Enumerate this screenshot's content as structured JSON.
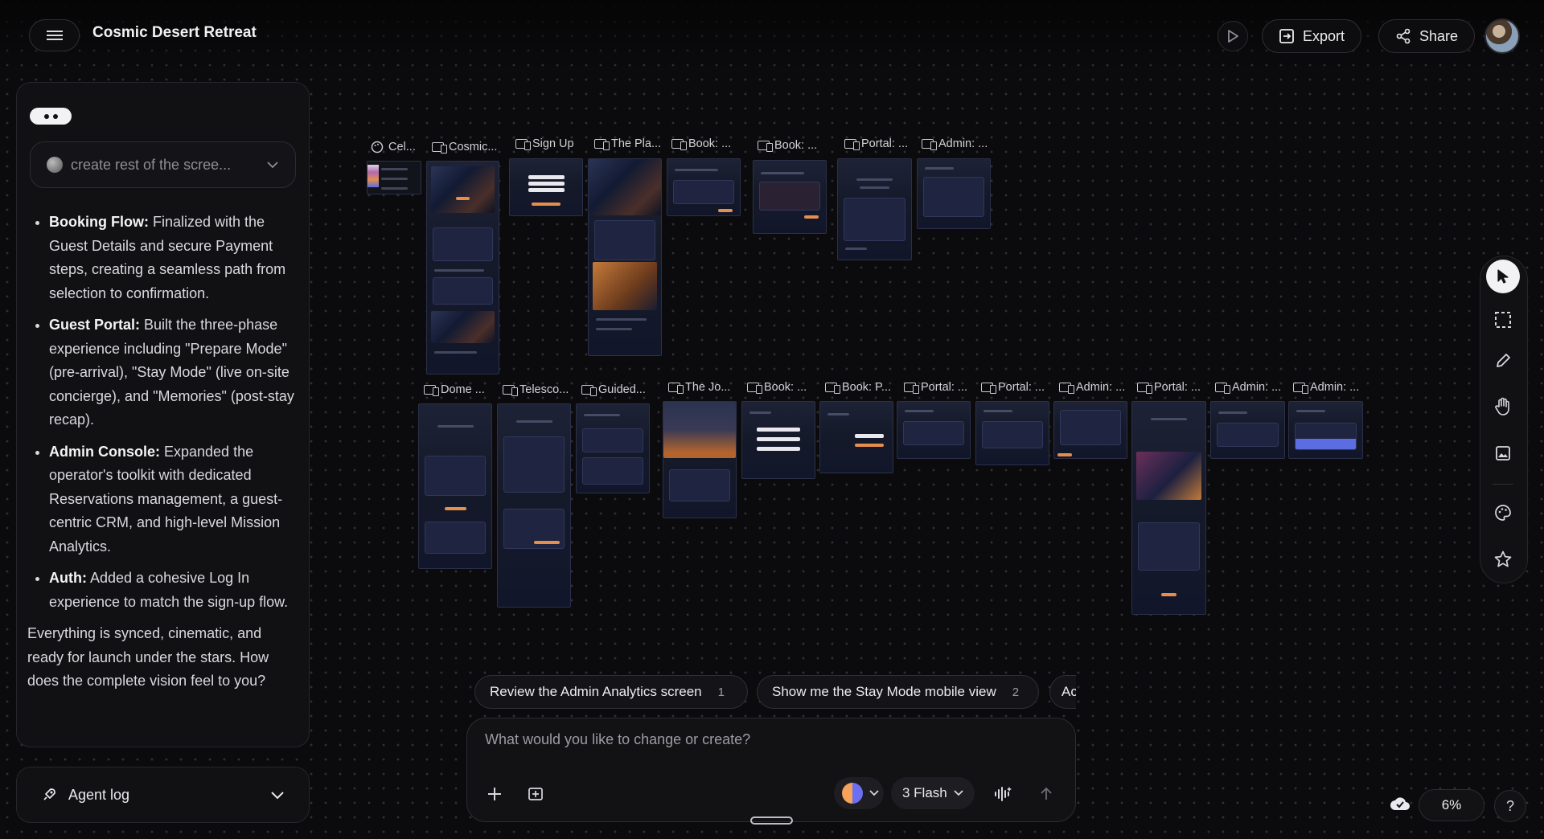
{
  "app": {
    "title": "Cosmic Desert Retreat"
  },
  "header": {
    "export_label": "Export",
    "share_label": "Share"
  },
  "panel": {
    "prompt_summary": "create rest of the scree...",
    "bullets": [
      {
        "head": "Booking Flow:",
        "body": " Finalized with the Guest Details and secure Payment steps, creating a seamless path from selection to confirmation."
      },
      {
        "head": "Guest Portal:",
        "body": " Built the three-phase experience including \"Prepare Mode\" (pre-arrival), \"Stay Mode\" (live on-site concierge), and \"Memories\" (post-stay recap)."
      },
      {
        "head": "Admin Console:",
        "body": " Expanded the operator's toolkit with dedicated Reservations management, a guest-centric CRM, and high-level Mission Analytics."
      },
      {
        "head": "Auth:",
        "body": " Added a cohesive Log In experience to match the sign-up flow."
      }
    ],
    "closing": "Everything is synced, cinematic, and ready for launch under the stars. How does the complete vision feel to you?",
    "agent_log_label": "Agent log"
  },
  "canvas": {
    "row1_labels": [
      "Cel...",
      "Cosmic...",
      "Sign Up",
      "The Pla...",
      "Book: ...",
      "Book: ...",
      "Portal: ...",
      "Admin: ..."
    ],
    "row2_labels": [
      "Dome ...",
      "Telesco...",
      "Guided...",
      "The Jo...",
      "Book: ...",
      "Book: P...",
      "Portal: ...",
      "Portal: ...",
      "Admin: ...",
      "Portal: ...",
      "Admin: ...",
      "Admin: ..."
    ]
  },
  "suggestions": [
    {
      "label": "Review the Admin Analytics screen",
      "num": "1"
    },
    {
      "label": "Show me the Stay Mode mobile view",
      "num": "2"
    },
    {
      "label": "Ac",
      "num": ""
    }
  ],
  "composer": {
    "placeholder": "What would you like to change or create?",
    "model": "3 Flash"
  },
  "zoom": {
    "level": "6%"
  },
  "help": {
    "label": "?"
  },
  "icons": {
    "menu": "menu-icon",
    "play": "play-icon",
    "export": "export-icon",
    "share": "share-icon",
    "pointer": "pointer-icon",
    "select": "marquee-select-icon",
    "pen": "pencil-icon",
    "hand": "hand-icon",
    "image": "image-icon",
    "palette": "palette-icon",
    "star": "star-icon",
    "rocket": "rocket-icon",
    "plus": "plus-icon",
    "add-frame": "add-frame-icon",
    "voice": "voice-icon",
    "send": "send-arrow-icon",
    "chevron": "chevron-down-icon",
    "cloud": "cloud-check-icon"
  },
  "colors": {
    "background": "#0b0b0d",
    "accent_orange": "#e58f4d",
    "frame_navy": "#151a2a"
  }
}
